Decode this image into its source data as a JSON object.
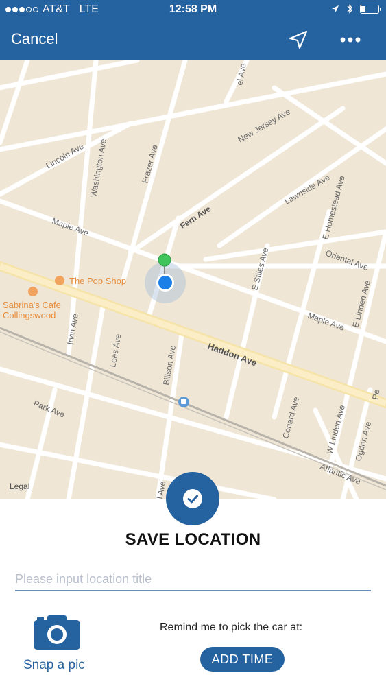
{
  "status_bar": {
    "carrier": "AT&T",
    "network": "LTE",
    "time": "12:58 PM"
  },
  "nav": {
    "cancel_label": "Cancel"
  },
  "map": {
    "streets": [
      "Lincoln Ave",
      "Washington Ave",
      "Frazer Ave",
      "New Jersey Ave",
      "Lawnside Ave",
      "E Homestead Ave",
      "Fern Ave",
      "Maple Ave",
      "Oriental Ave",
      "E Stiles Ave",
      "E Linden Ave",
      "Maple Ave",
      "Irvin Ave",
      "Lees Ave",
      "Billson Ave",
      "Haddon Ave",
      "Park Ave",
      "Conard Ave",
      "W Linden Ave",
      "Ogden Ave",
      "Atlantic Ave",
      "el Ave",
      "Pe",
      "ill Ave"
    ],
    "places": [
      "The Pop Shop",
      "Sabrina's Cafe",
      "Collingswood"
    ],
    "legal_label": "Legal"
  },
  "panel": {
    "title": "SAVE LOCATION",
    "input_placeholder": "Please input location title",
    "input_value": "",
    "snap_label": "Snap a pic",
    "remind_label": "Remind me to pick the car at:",
    "add_time_label": "ADD TIME"
  },
  "colors": {
    "brand": "#2562a0",
    "map_bg": "#efe6d6",
    "main_road": "#f7e6b4"
  }
}
